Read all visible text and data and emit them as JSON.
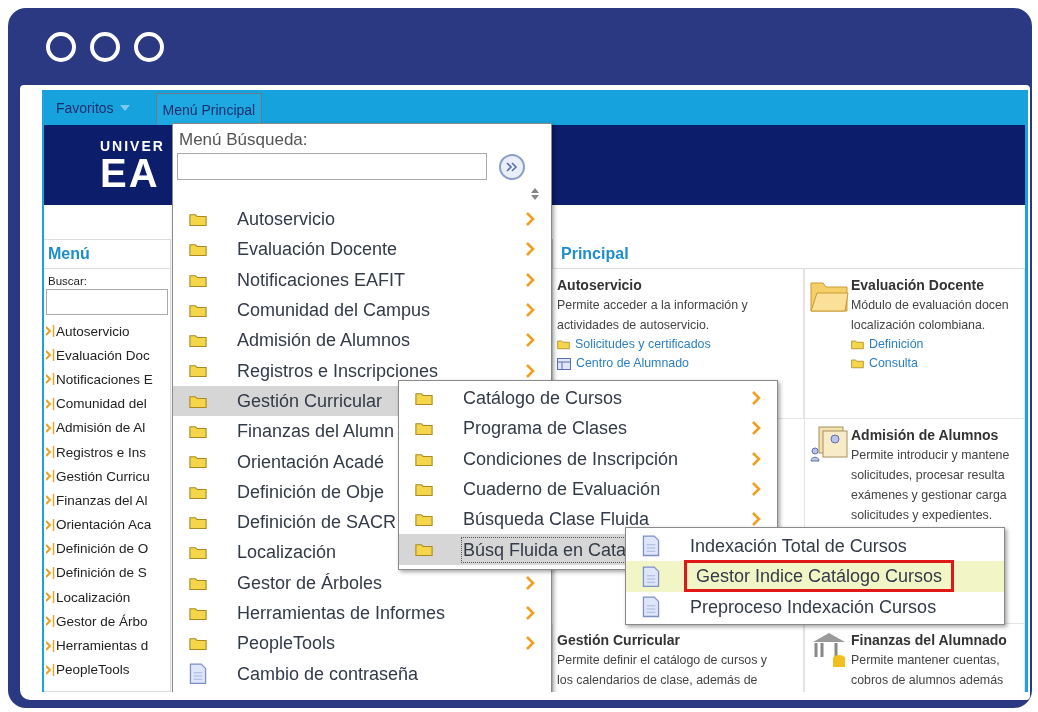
{
  "top_bar": {
    "tabs": [
      {
        "label": "Favoritos",
        "selected": false,
        "dropdown": true
      },
      {
        "label": "Menú Principal",
        "selected": true,
        "dropdown": false
      }
    ]
  },
  "banner": {
    "logo_top": "UNIVER",
    "logo_main": "EA"
  },
  "sidebar": {
    "title": "Menú",
    "search_label": "Buscar:",
    "items": [
      "Autoservicio",
      "Evaluación Doc",
      "Notificaciones E",
      "Comunidad del",
      "Admisión de Al",
      "Registros e Ins",
      "Gestión Curricu",
      "Finanzas del Al",
      "Orientación Aca",
      "Definición de O",
      "Definición de S",
      "Localización",
      "Gestor de Árbo",
      "Herramientas d",
      "PeopleTools"
    ]
  },
  "content": {
    "title": "Principal",
    "cards": [
      {
        "title": "Autoservicio",
        "lines": [
          "Permite acceder a la información y",
          "actividades de autoservicio."
        ],
        "links": [
          {
            "label": "Solicitudes y certificados",
            "kind": "folder"
          },
          {
            "label": "Centro de Alumnado",
            "kind": "table"
          }
        ]
      },
      {
        "title": "Evaluación Docente",
        "lines": [
          "Módulo de evaluación docen",
          "localización colombiana."
        ],
        "links": [
          {
            "label": "Definición",
            "kind": "folder"
          },
          {
            "label": "Consulta",
            "kind": "folder"
          }
        ]
      },
      {
        "title": "Admisión de Alumnos",
        "lines": [
          "Permite introducir y mantene",
          "solicitudes, procesar resulta",
          "exámenes y gestionar carga",
          "solicitudes y expedientes."
        ]
      },
      {
        "title": "Gestión Curricular",
        "lines": [
          "Permite definir el catálogo de cursos y",
          "los calendarios de clase, además de"
        ]
      },
      {
        "title": "Finanzas del Alumnado",
        "lines": [
          "Permite mantener cuentas,",
          "cobros de alumnos además"
        ]
      }
    ]
  },
  "main_menu": {
    "search_label": "Menú Búsqueda:",
    "items": [
      {
        "label": "Autoservicio",
        "kind": "folder",
        "arrow": true,
        "selected": false
      },
      {
        "label": "Evaluación Docente",
        "kind": "folder",
        "arrow": true,
        "selected": false
      },
      {
        "label": "Notificaciones EAFIT",
        "kind": "folder",
        "arrow": true,
        "selected": false
      },
      {
        "label": "Comunidad del Campus",
        "kind": "folder",
        "arrow": true,
        "selected": false
      },
      {
        "label": "Admisión de Alumnos",
        "kind": "folder",
        "arrow": true,
        "selected": false
      },
      {
        "label": "Registros e Inscripciones",
        "kind": "folder",
        "arrow": true,
        "selected": false
      },
      {
        "label": "Gestión Curricular",
        "kind": "folder",
        "arrow": false,
        "selected": true
      },
      {
        "label": "Finanzas del Alumn",
        "kind": "folder",
        "arrow": false,
        "selected": false
      },
      {
        "label": "Orientación Acadé",
        "kind": "folder",
        "arrow": false,
        "selected": false
      },
      {
        "label": "Definición de Obje",
        "kind": "folder",
        "arrow": false,
        "selected": false
      },
      {
        "label": "Definición de SACR",
        "kind": "folder",
        "arrow": false,
        "selected": false
      },
      {
        "label": "Localización",
        "kind": "folder",
        "arrow": false,
        "selected": false
      },
      {
        "label": "Gestor de Árboles",
        "kind": "folder",
        "arrow": true,
        "selected": false
      },
      {
        "label": "Herramientas de Informes",
        "kind": "folder",
        "arrow": true,
        "selected": false
      },
      {
        "label": "PeopleTools",
        "kind": "folder",
        "arrow": true,
        "selected": false
      },
      {
        "label": "Cambio de contraseña",
        "kind": "page",
        "arrow": false,
        "selected": false
      }
    ]
  },
  "submenu": {
    "items": [
      {
        "label": "Catálogo de Cursos",
        "kind": "folder",
        "arrow": true,
        "selected": false
      },
      {
        "label": "Programa de Clases",
        "kind": "folder",
        "arrow": true,
        "selected": false
      },
      {
        "label": "Condiciones de Inscripción",
        "kind": "folder",
        "arrow": true,
        "selected": false
      },
      {
        "label": "Cuaderno de Evaluación",
        "kind": "folder",
        "arrow": true,
        "selected": false
      },
      {
        "label": "Búsqueda Clase Fluida",
        "kind": "folder",
        "arrow": true,
        "selected": false
      },
      {
        "label": "Búsq Fluida en Cata",
        "kind": "folder",
        "arrow": false,
        "selected": true
      }
    ]
  },
  "sub_submenu": {
    "items": [
      {
        "label": "Indexación Total de Cursos",
        "kind": "page",
        "selected": false,
        "outlined": false
      },
      {
        "label": "Gestor Indice Catálogo Cursos",
        "kind": "page",
        "selected": true,
        "outlined": true
      },
      {
        "label": "Preproceso Indexación Cursos",
        "kind": "page",
        "selected": false,
        "outlined": false
      }
    ]
  }
}
